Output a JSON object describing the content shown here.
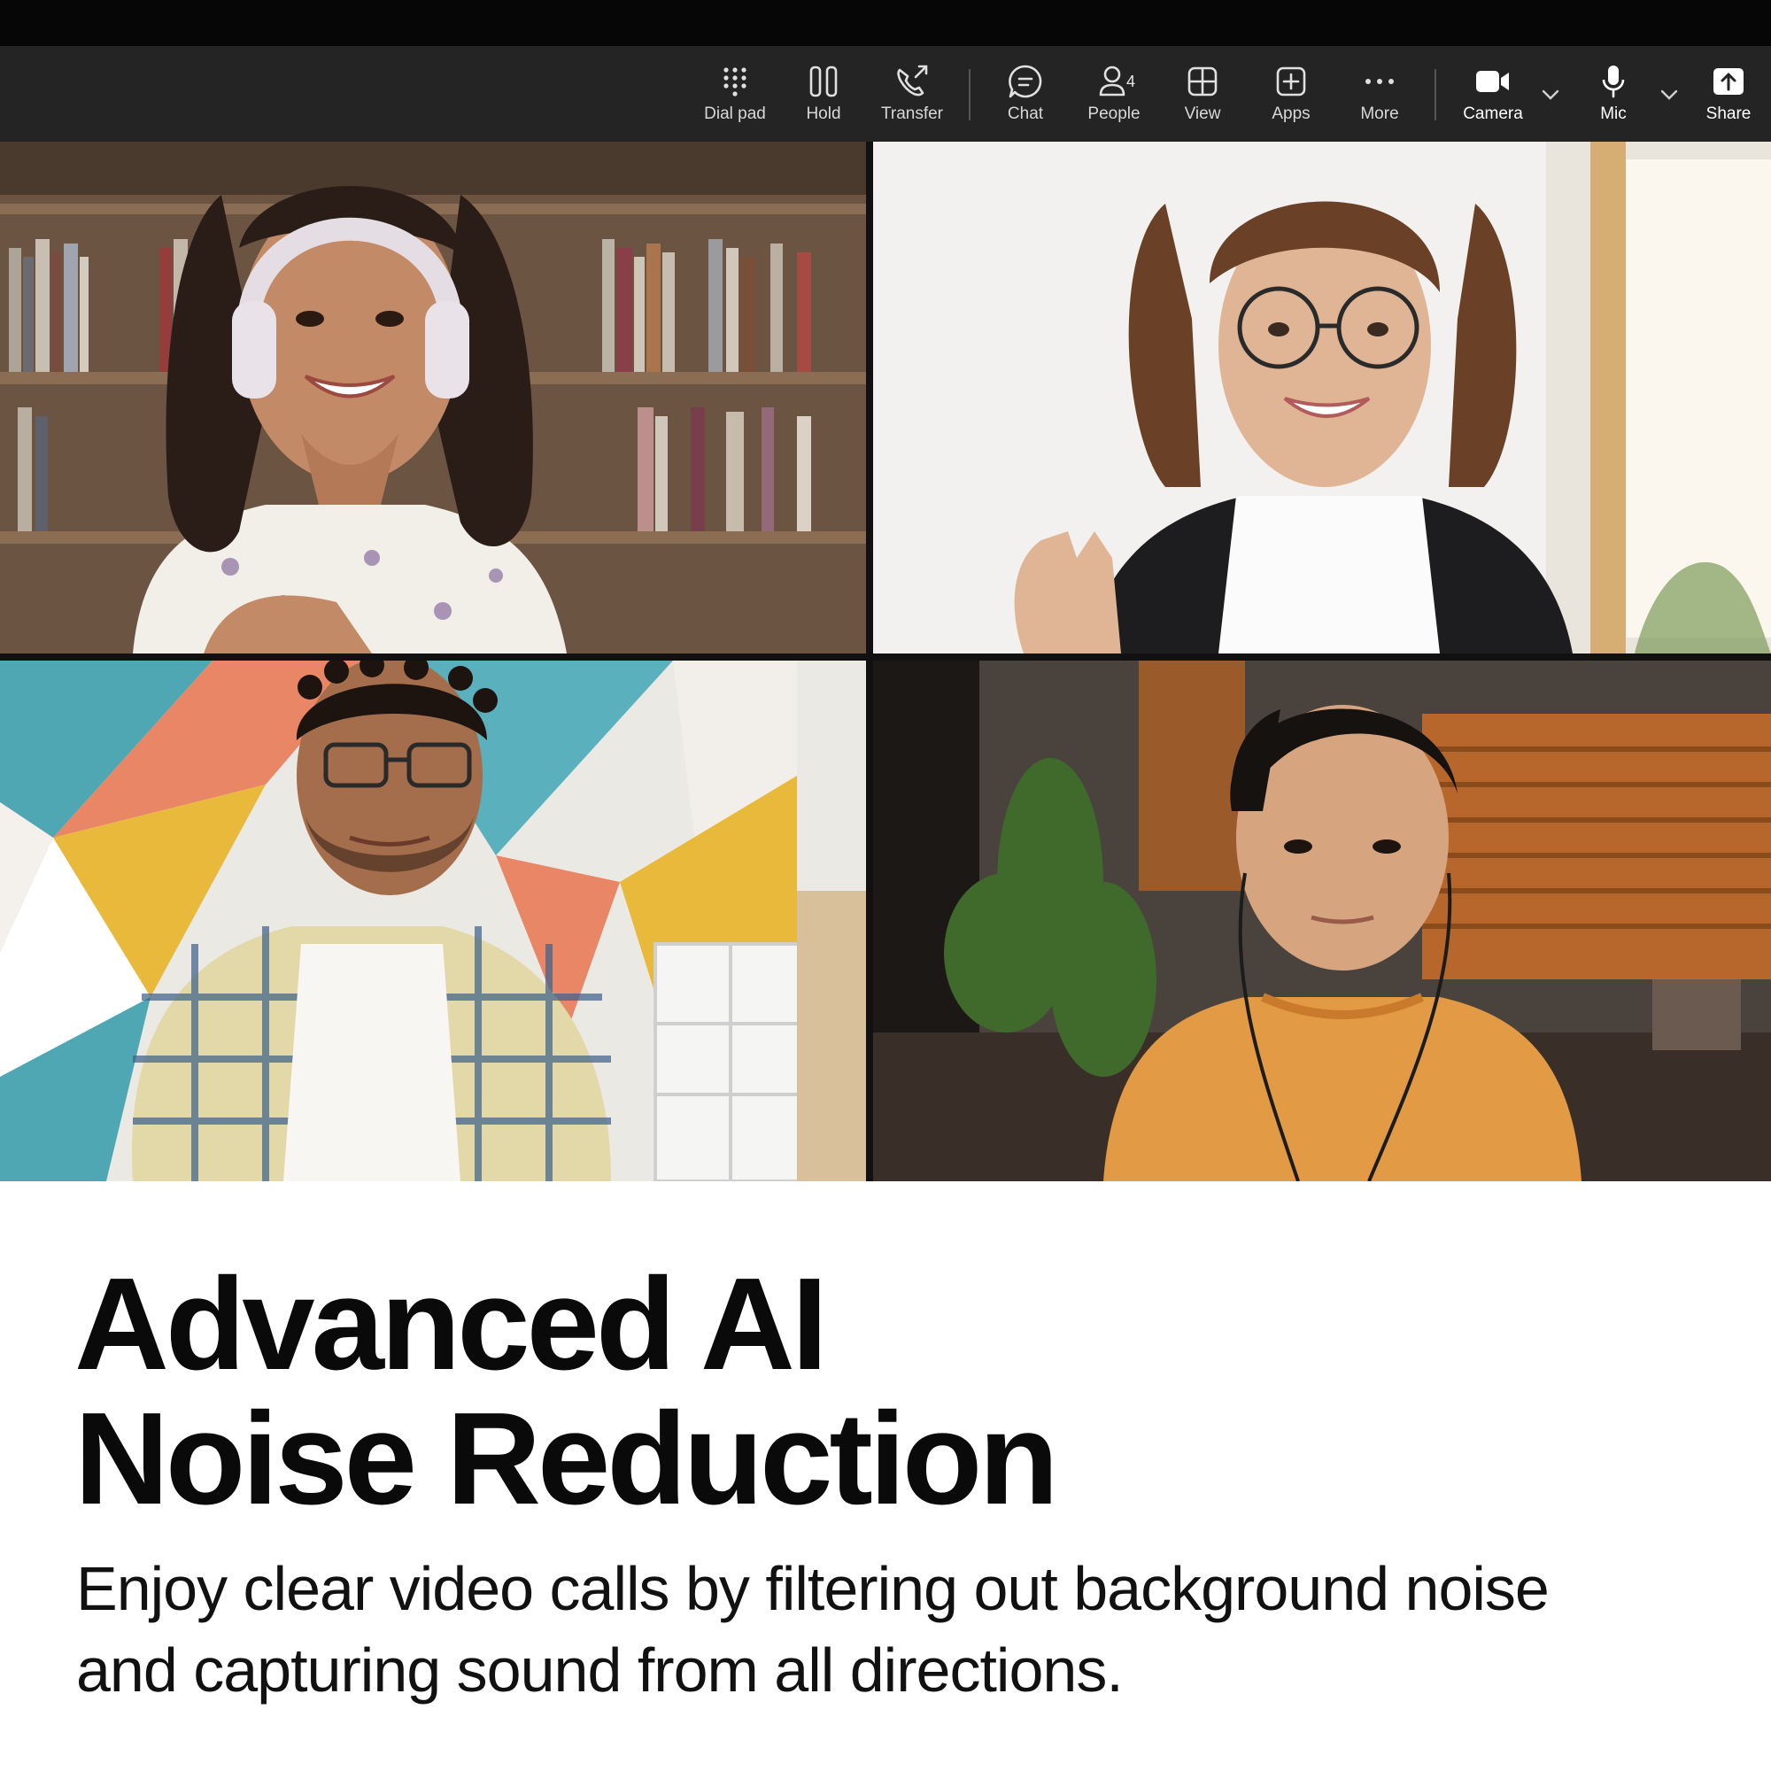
{
  "toolbar": {
    "buttons": {
      "dialpad": "Dial pad",
      "hold": "Hold",
      "transfer": "Transfer",
      "chat": "Chat",
      "people": "People",
      "view": "View",
      "apps": "Apps",
      "more": "More",
      "camera": "Camera",
      "mic": "Mic",
      "share": "Share"
    },
    "people_count": "4",
    "colors": {
      "background": "#242424",
      "text": "#d8d8d8",
      "top_strip": "#060606"
    }
  },
  "video_grid": {
    "tiles": [
      {
        "id": "participant-1",
        "background": "bookshelf"
      },
      {
        "id": "participant-2",
        "background": "bright-room"
      },
      {
        "id": "participant-3",
        "background": "geometric-wall"
      },
      {
        "id": "participant-4",
        "background": "home-office"
      }
    ]
  },
  "promo": {
    "headline_line1": "Advanced AI",
    "headline_line2": "Noise Reduction",
    "body_line1": "Enjoy clear video calls by filtering out background noise",
    "body_line2": "and capturing sound from all directions."
  }
}
